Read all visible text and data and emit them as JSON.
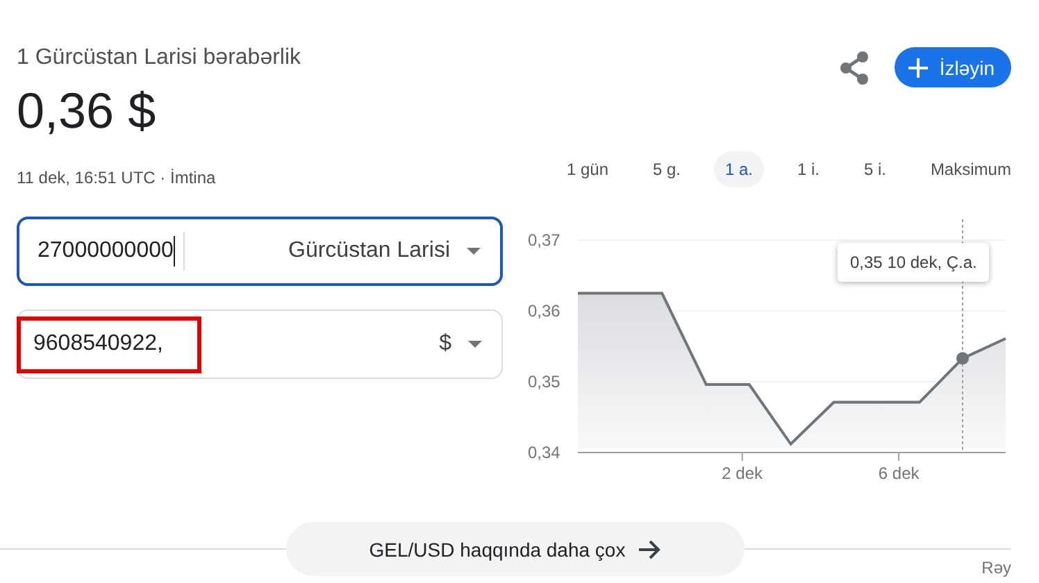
{
  "header": {
    "title": "1 Gürcüstan Larisi bərabərlik",
    "price": "0,36 $",
    "meta": "11 dek, 16:51 UTC · İmtina"
  },
  "follow_button": {
    "label": "İzləyin"
  },
  "ranges": [
    {
      "label": "1 gün",
      "selected": false
    },
    {
      "label": "5 g.",
      "selected": false
    },
    {
      "label": "1 a.",
      "selected": true
    },
    {
      "label": "1 i.",
      "selected": false
    },
    {
      "label": "5 i.",
      "selected": false
    },
    {
      "label": "Maksimum",
      "selected": false
    }
  ],
  "converter": [
    {
      "amount": "27000000000",
      "currency": "Gürcüstan Larisi",
      "focused": true,
      "highlighted": false
    },
    {
      "amount": "9608540922,",
      "currency": "$",
      "focused": false,
      "highlighted": true
    }
  ],
  "chart": {
    "chart_data": {
      "type": "area",
      "x": [
        -2.2,
        -0.05,
        1.08,
        2.18,
        3.24,
        4.34,
        6.53,
        7.63,
        8.73
      ],
      "series": [
        {
          "color": "#70757a",
          "values": [
            0.3625,
            0.3625,
            0.3496,
            0.3496,
            0.3412,
            0.3471,
            0.3471,
            0.3533,
            0.3561
          ]
        }
      ],
      "xlim": [
        -2.2,
        8.73
      ],
      "ylim": [
        0.34,
        0.37
      ],
      "xticks": [
        {
          "value": 2,
          "label": "2 dek"
        },
        {
          "value": 6,
          "label": "6 dek"
        }
      ],
      "yticks": [
        {
          "value": 0.34,
          "label": "0,34"
        },
        {
          "value": 0.35,
          "label": "0,35"
        },
        {
          "value": 0.36,
          "label": "0,36"
        },
        {
          "value": 0.37,
          "label": "0,37"
        }
      ],
      "ref_lines": [
        {
          "axis": "x",
          "value": 7.63
        }
      ],
      "annotations": [
        "0,35 10 dek, Ç.a."
      ]
    }
  },
  "more_button": {
    "label": "GEL/USD haqqında daha çox"
  },
  "feedback": "Rəy"
}
